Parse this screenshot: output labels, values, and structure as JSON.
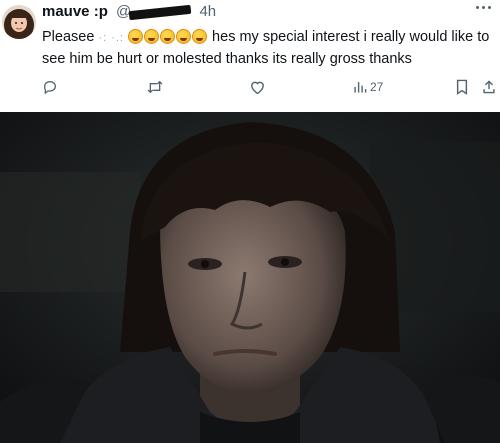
{
  "tweet": {
    "display_name": "mauve :p",
    "handle_prefix": "@",
    "timestamp": "4h",
    "text_start": "Pleasee",
    "text_scribble": "·: ·.:",
    "text_rest": " hes my special interest i really would  like to see him be hurt or molested thanks its really gross thanks",
    "emoji_count": 5
  },
  "actions": {
    "reply_icon": "reply-icon",
    "retweet_icon": "retweet-icon",
    "like_icon": "heart-icon",
    "views_icon": "views-icon",
    "views_count": "27",
    "bookmark_icon": "bookmark-icon",
    "share_icon": "share-icon"
  },
  "colors": {
    "text": "#0f1419",
    "secondary": "#536471",
    "photo_background": "#1c1f20"
  }
}
